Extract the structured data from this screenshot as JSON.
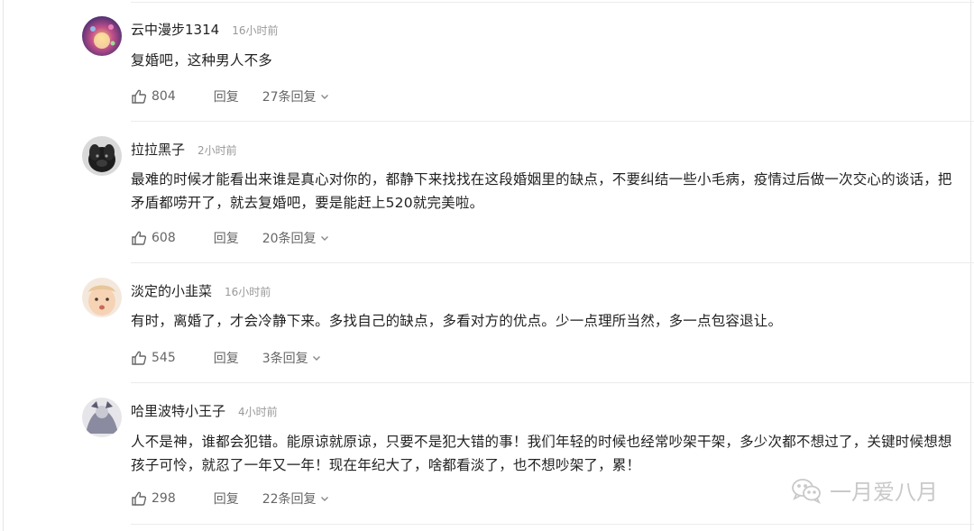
{
  "comments": [
    {
      "user": "云中漫步1314",
      "time": "16小时前",
      "text": "复婚吧，这种男人不多",
      "likes": "804",
      "reply_label": "回复",
      "replies": "27条回复"
    },
    {
      "user": "拉拉黑子",
      "time": "2小时前",
      "text": "最难的时候才能看出来谁是真心对你的，都静下来找找在这段婚姻里的缺点，不要纠结一些小毛病，疫情过后做一次交心的谈话，把矛盾都唠开了，就去复婚吧，要是能赶上520就完美啦。",
      "likes": "608",
      "reply_label": "回复",
      "replies": "20条回复"
    },
    {
      "user": "淡定的小韭菜",
      "time": "16小时前",
      "text": "有时，离婚了，才会冷静下来。多找自己的缺点，多看对方的优点。少一点理所当然，多一点包容退让。",
      "likes": "545",
      "reply_label": "回复",
      "replies": "3条回复"
    },
    {
      "user": "哈里波特小王子",
      "time": "4小时前",
      "text": "人不是神，谁都会犯错。能原谅就原谅，只要不是犯大错的事！我们年轻的时候也经常吵架干架，多少次都不想过了，关键时候想想孩子可怜，就忍了一年又一年！现在年纪大了，啥都看淡了，也不想吵架了，累！",
      "likes": "298",
      "reply_label": "回复",
      "replies": "22条回复"
    }
  ],
  "watermark": "一月爱八月",
  "icons": {
    "like": "thumbs-up-icon",
    "expand": "chevron-down-icon",
    "watermark": "wechat-icon"
  }
}
